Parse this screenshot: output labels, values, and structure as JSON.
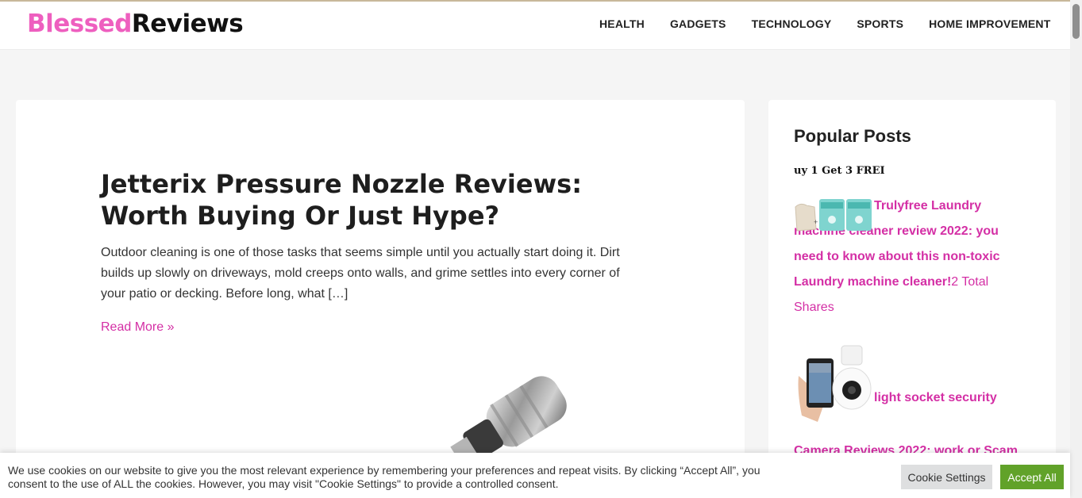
{
  "header": {
    "logo_part1": "Blessed",
    "logo_part2": "Reviews",
    "nav": [
      {
        "label": "HEALTH"
      },
      {
        "label": "GADGETS"
      },
      {
        "label": "TECHNOLOGY"
      },
      {
        "label": "SPORTS"
      },
      {
        "label": "HOME IMPROVEMENT"
      }
    ]
  },
  "article": {
    "title": "Jetterix Pressure Nozzle Reviews: Worth Buying Or Just Hype?",
    "excerpt": "Outdoor cleaning is one of those tasks that seems simple until you actually start doing it. Dirt builds up slowly on driveways, mold creeps onto walls, and grime settles into every corner of your patio or decking. Before long, what […]",
    "read_more": "Read More »"
  },
  "sidebar": {
    "title": "Popular Posts",
    "promo_text": "uy 1 Get 3 FREI",
    "posts": [
      {
        "title": "Trulyfree Laundry machine cleaner review 2022: you need to know about this non-toxic Laundry machine cleaner!",
        "shares": "2 Total Shares"
      },
      {
        "title": "light socket security Camera Reviews 2022: work or Scam"
      }
    ]
  },
  "cookie": {
    "text": "We use cookies on our website to give you the most relevant experience by remembering your preferences and repeat visits. By clicking “Accept All”, you consent to the use of ALL the cookies. However, you may visit \"Cookie Settings\" to provide a controlled consent.",
    "settings_label": "Cookie Settings",
    "accept_label": "Accept All"
  },
  "colors": {
    "brand_pink": "#ee5fbf",
    "link_pink": "#d42fa5",
    "accept_green": "#61a229"
  }
}
